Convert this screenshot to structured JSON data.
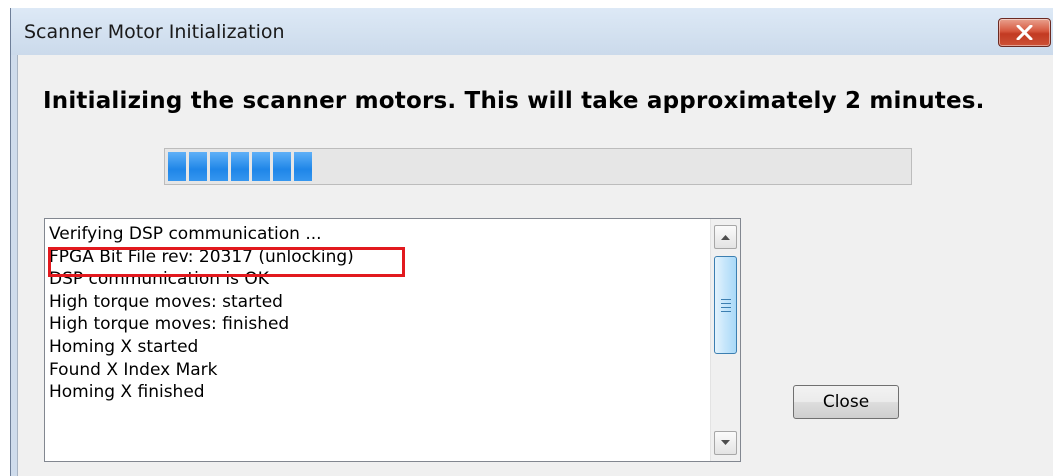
{
  "window": {
    "title": "Scanner Motor Initialization",
    "close_icon": "close-x-icon",
    "accent_close_color": "#c94a34"
  },
  "dialog": {
    "message": "Initializing the scanner motors.  This will take approximately 2 minutes.",
    "progress": {
      "filled_segments": 7,
      "fraction": 0.2,
      "color": "#1f86e8"
    },
    "log": {
      "lines": [
        "Verifying DSP communication ...",
        "FPGA Bit File rev: 20317 (unlocking)",
        "DSP communication is OK",
        "High torque moves: started",
        "High torque moves: finished",
        "Homing X started",
        "Found X Index Mark",
        "Homing X finished"
      ],
      "highlighted_line": 1,
      "highlight_color": "#e2191e"
    },
    "close_button_label": "Close"
  }
}
